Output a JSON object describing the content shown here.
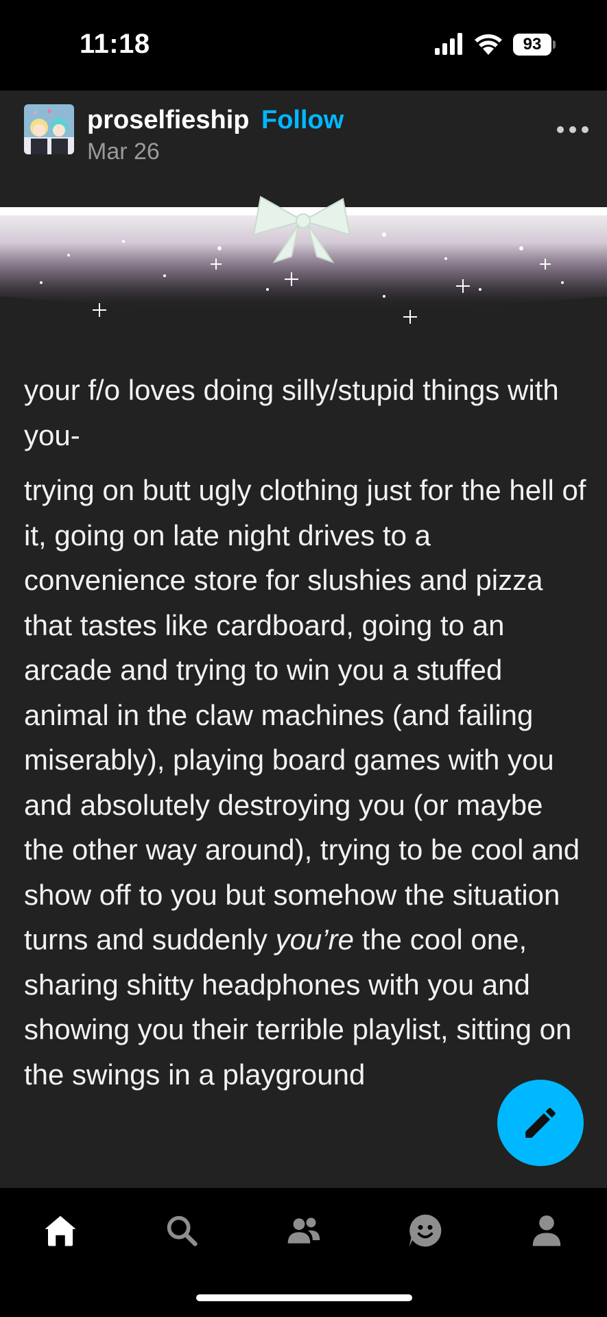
{
  "status_bar": {
    "time": "11:18",
    "battery": "93"
  },
  "post": {
    "username": "proselfieship",
    "follow_label": "Follow",
    "date": "Mar 26",
    "body": {
      "p1": "your f/o loves doing silly/stupid things with you-",
      "p2_before": "trying on butt ugly clothing just for the hell of it, going on late night drives to a convenience store for slushies and pizza that tastes like cardboard, going to an arcade and trying to win you a stuffed animal in the claw machines (and failing miserably), playing board games with you and absolutely destroying you (or maybe the other way around), trying to be cool and show off to you but somehow the situation turns and suddenly ",
      "p2_emphasis": "you’re",
      "p2_after": " the cool one, sharing shitty headphones with you and showing you their terrible playlist, sitting on the swings in a playground"
    }
  },
  "colors": {
    "accent": "#00b8ff",
    "post_background": "#222222",
    "chrome_background": "#000000"
  },
  "icons": {
    "more": "more-options-icon",
    "compose": "pencil-icon",
    "nav": [
      "home-icon",
      "search-icon",
      "people-icon",
      "activity-face-icon",
      "profile-icon"
    ]
  }
}
